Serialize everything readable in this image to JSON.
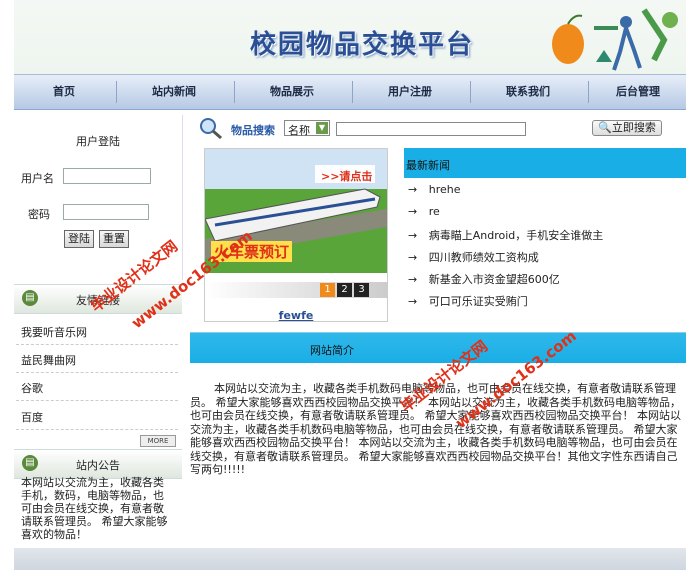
{
  "header": {
    "title": "校园物品交换平台"
  },
  "nav": {
    "items": [
      "首页",
      "站内新闻",
      "物品展示",
      "用户注册",
      "联系我们",
      "后台管理"
    ]
  },
  "login": {
    "title": "用户登陆",
    "username_label": "用户名",
    "password_label": "密码",
    "login_button": "登陆",
    "reset_button": "重置"
  },
  "friends": {
    "title": "友情链接",
    "items": [
      "我要听音乐网",
      "益民舞曲网",
      "谷歌",
      "百度"
    ],
    "more": "MORE"
  },
  "notice": {
    "title": "站内公告",
    "text": "本网站以交流为主，收藏各类手机，数码，电脑等物品，也可由会员在线交换，有意者敬请联系管理员。 希望大家能够喜欢的物品！"
  },
  "search": {
    "label": "物品搜索",
    "select_value": "名称",
    "query": "",
    "button": "立即搜索"
  },
  "featured": {
    "promo_top": ">>请点击",
    "promo_main": "火车票预订",
    "pages": [
      "1",
      "2",
      "3"
    ],
    "caption": "fewfe"
  },
  "news": {
    "title": "最新新闻",
    "items": [
      "hrehe",
      "re",
      "病毒瞄上Android，手机安全谁做主",
      "四川教师绩效工资构成",
      "新基金入市资金望超600亿",
      "可口可乐证实受贿门"
    ]
  },
  "intro": {
    "title": "网站简介",
    "text": "本网站以交流为主，收藏各类手机数码电脑等物品，也可由会员在线交换，有意者敬请联系管理员。 希望大家能够喜欢西西校园物品交换平台！ 本网站以交流为主，收藏各类手机数码电脑等物品，也可由会员在线交换，有意者敬请联系管理员。 希望大家能够喜欢西西校园物品交换平台！ 本网站以交流为主，收藏各类手机数码电脑等物品，也可由会员在线交换，有意者敬请联系管理员。 希望大家能够喜欢西西校园物品交换平台！ 本网站以交流为主，收藏各类手机数码电脑等物品，也可由会员在线交换，有意者敬请联系管理员。 希望大家能够喜欢西西校园物品交换平台！其他文字性东西请自己写两句!!!!!"
  },
  "watermarks": [
    "毕业设计论文网",
    "www.doc163.com"
  ],
  "colors": {
    "accent": "#1aaee6",
    "title": "#2a4f94",
    "watermark": "#e03018"
  }
}
